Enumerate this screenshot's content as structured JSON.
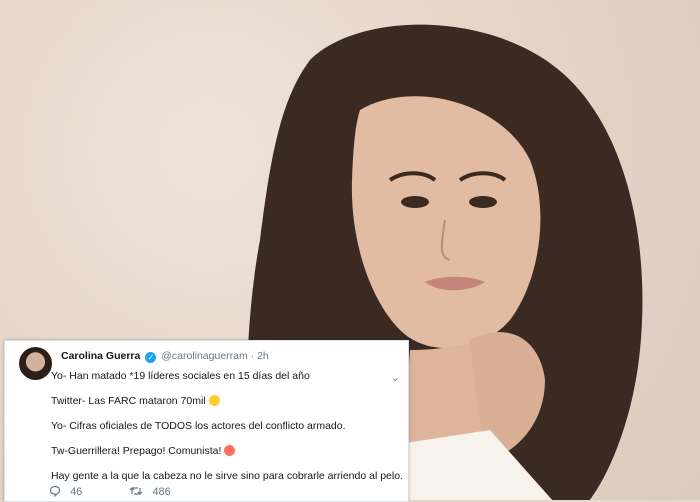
{
  "tweet": {
    "author_name": "Carolina Guerra",
    "handle": "@carolinaguerram",
    "time": "· 2h",
    "lines": [
      "Yo- Han matado *19 líderes sociales en 15 días del año",
      "Twitter- Las FARC mataron 70mil",
      "Yo- Cifras oficiales de TODOS los actores del conflicto armado.",
      "Tw-Guerrillera! Prepago! Comunista!",
      "Hay gente a la que la cabeza no le sirve sino para cobrarle arriendo al pelo."
    ],
    "reply_count": "46",
    "retweet_count": "486"
  },
  "icons": {
    "verified": "verified-badge-icon",
    "reply": "reply-icon",
    "retweet": "retweet-icon",
    "menu": "chevron-down-icon"
  },
  "colors": {
    "verified_blue": "#1da1f2",
    "secondary_text": "#657786",
    "background_beige": "#e6d7cb"
  }
}
